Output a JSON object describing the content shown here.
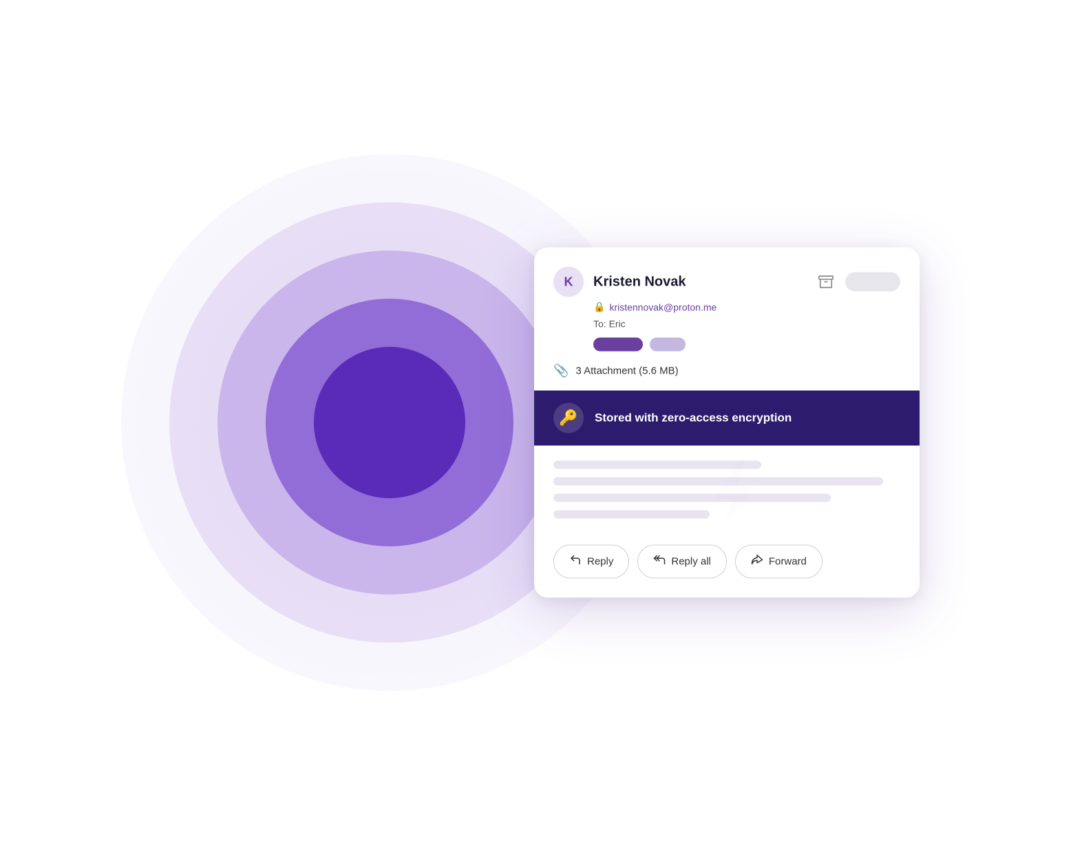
{
  "background": {
    "colors": {
      "circle1": "rgba(180,160,230,0.15)",
      "circle2": "rgba(160,120,220,0.18)",
      "circle3": "rgba(130,80,210,0.28)",
      "circle4": "rgba(100,50,200,0.55)",
      "circle5": "rgba(80,30,180,0.85)"
    }
  },
  "email_card": {
    "avatar_initial": "K",
    "sender_name": "Kristen Novak",
    "sender_email": "kristennovak@proton.me",
    "to_label": "To:",
    "to_recipient": "Eric",
    "attachment_text": "3 Attachment (5.6 MB)",
    "encryption_banner": {
      "text": "Stored with zero-access encryption"
    },
    "actions": {
      "reply_label": "Reply",
      "reply_all_label": "Reply all",
      "forward_label": "Forward"
    }
  }
}
